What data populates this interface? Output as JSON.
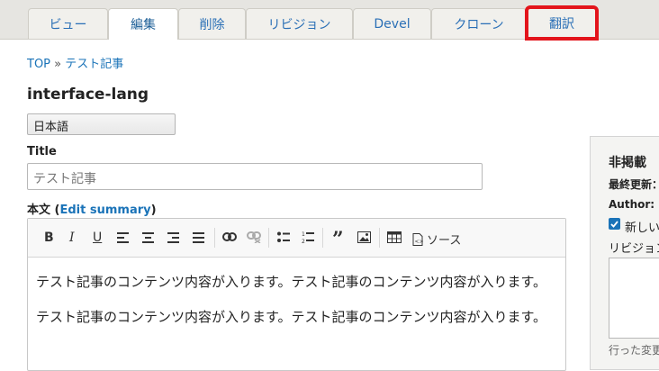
{
  "tabs": [
    {
      "label": "ビュー"
    },
    {
      "label": "編集"
    },
    {
      "label": "削除"
    },
    {
      "label": "リビジョン"
    },
    {
      "label": "Devel"
    },
    {
      "label": "クローン"
    },
    {
      "label": "翻訳"
    }
  ],
  "active_tab": "編集",
  "highlighted_tab": "翻訳",
  "highlight_color": "#e3141b",
  "breadcrumb": {
    "home": "TOP",
    "separator": "»",
    "current": "テスト記事"
  },
  "page_title": "interface-lang",
  "language_select": {
    "value": "日本語"
  },
  "title_field": {
    "label": "Title",
    "value": "テスト記事"
  },
  "body_field": {
    "label": "本文",
    "edit_summary_open": "(",
    "edit_summary_link": "Edit summary",
    "edit_summary_close": ")"
  },
  "editor_toolbar": {
    "source_label": "ソース"
  },
  "editor_content": {
    "paragraphs": [
      "テスト記事のコンテンツ内容が入ります。テスト記事のコンテンツ内容が入ります。",
      "テスト記事のコンテンツ内容が入ります。テスト記事のコンテンツ内容が入ります。"
    ]
  },
  "sidebar": {
    "title": "非掲載",
    "last_updated": "最終更新：",
    "author": "Author: ",
    "new_revision": "新しい",
    "revision_label": "リビジョン",
    "revision_note": "行った変更"
  }
}
